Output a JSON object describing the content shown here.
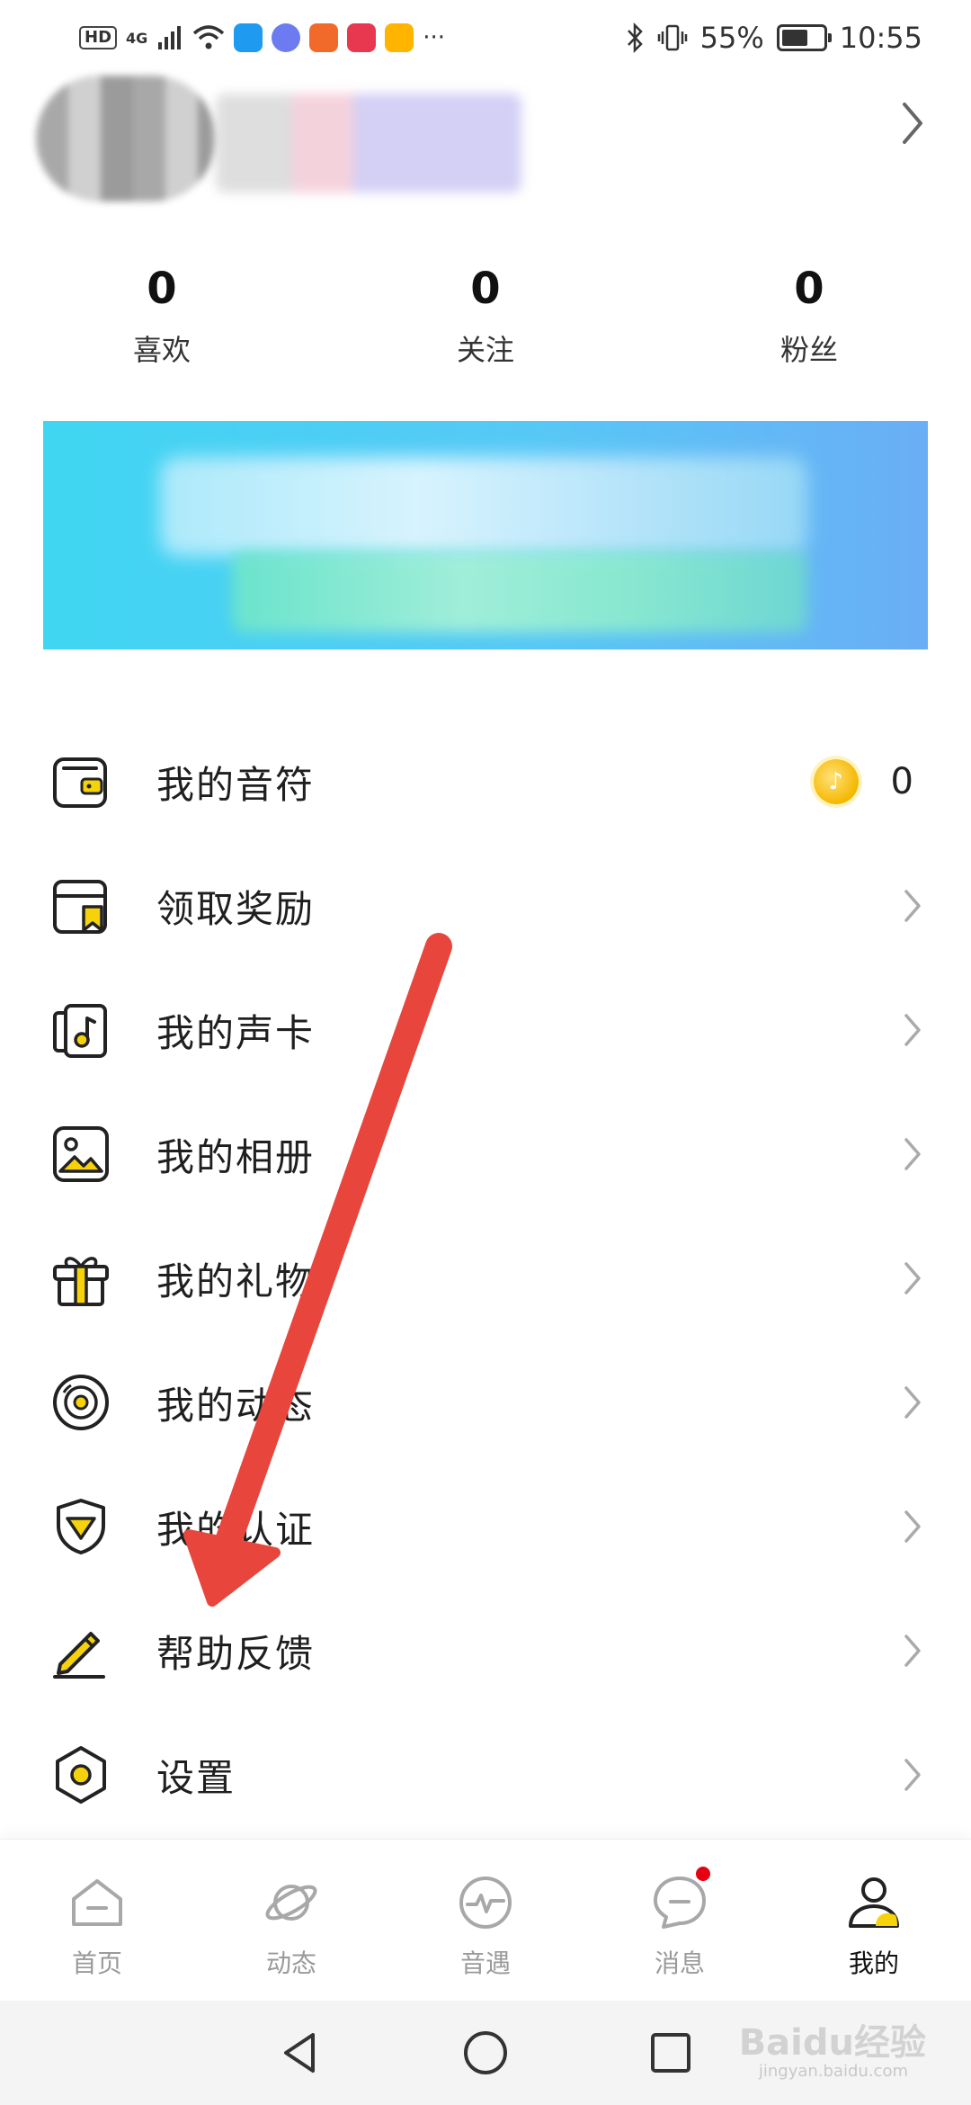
{
  "status_bar": {
    "hd_badge": "HD",
    "network": "4G",
    "more": "···",
    "battery_percent": "55%",
    "time": "10:55"
  },
  "stats": [
    {
      "value": "0",
      "label": "喜欢"
    },
    {
      "value": "0",
      "label": "关注"
    },
    {
      "value": "0",
      "label": "粉丝"
    }
  ],
  "menu": {
    "items": [
      {
        "label": "我的音符",
        "icon": "wallet-icon"
      },
      {
        "label": "领取奖励",
        "icon": "reward-icon"
      },
      {
        "label": "我的声卡",
        "icon": "sound-card-icon"
      },
      {
        "label": "我的相册",
        "icon": "album-icon"
      },
      {
        "label": "我的礼物",
        "icon": "gift-icon"
      },
      {
        "label": "我的动态",
        "icon": "record-disc-icon"
      },
      {
        "label": "我的认证",
        "icon": "shield-icon"
      },
      {
        "label": "帮助反馈",
        "icon": "pencil-icon"
      },
      {
        "label": "设置",
        "icon": "hexagon-gear-icon"
      }
    ],
    "notes_count": "0"
  },
  "tabbar": {
    "tabs": [
      {
        "label": "首页",
        "icon": "home-icon"
      },
      {
        "label": "动态",
        "icon": "planet-icon"
      },
      {
        "label": "音遇",
        "icon": "pulse-icon"
      },
      {
        "label": "消息",
        "icon": "chat-icon"
      },
      {
        "label": "我的",
        "icon": "person-icon"
      }
    ],
    "active_index": 4
  },
  "watermark": {
    "text": "Baidu经验",
    "sub": "jingyan.baidu.com"
  },
  "colors": {
    "accent": "#f5d20a",
    "badge_red": "#e60012",
    "annotation_arrow": "#e8453c"
  }
}
